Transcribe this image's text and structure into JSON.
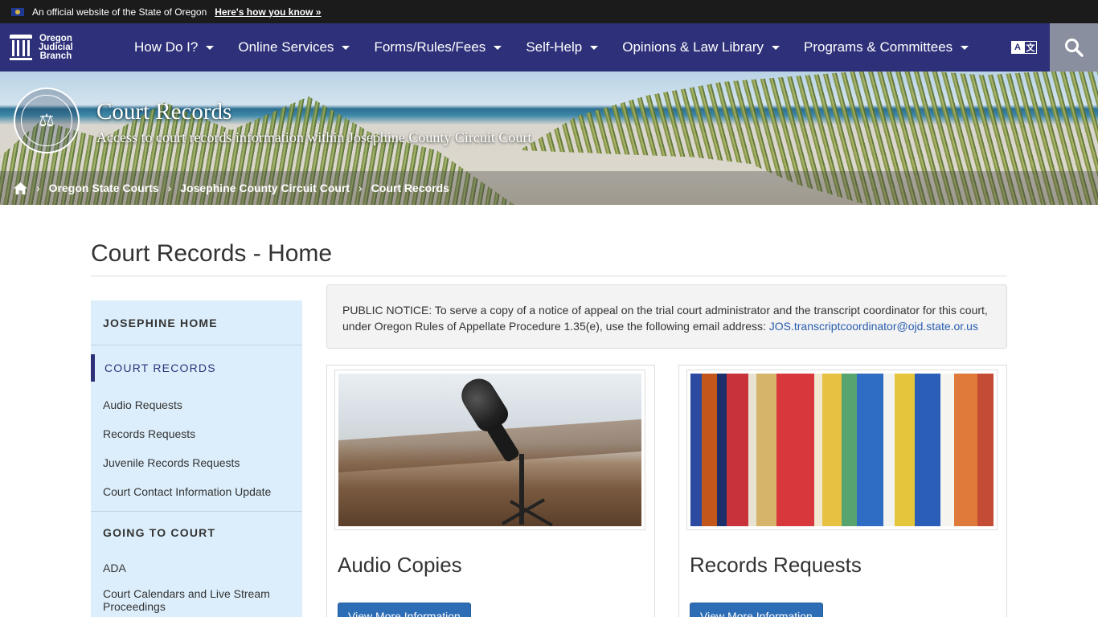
{
  "official_banner": {
    "text": "An official website of the State of Oregon",
    "link": "Here's how you know »"
  },
  "brand": {
    "line1": "Oregon",
    "line2": "Judicial",
    "line3": "Branch"
  },
  "nav": {
    "items": [
      {
        "label": "How Do I?"
      },
      {
        "label": "Online Services"
      },
      {
        "label": "Forms/Rules/Fees"
      },
      {
        "label": "Self-Help"
      },
      {
        "label": "Opinions & Law Library"
      },
      {
        "label": "Programs & Committees"
      }
    ],
    "translate_a": "A",
    "translate_b": "文"
  },
  "hero": {
    "title": "Court Records",
    "subtitle": "Access to court records information within Josephine County Circuit Court"
  },
  "breadcrumb": {
    "items": [
      {
        "label": "Oregon State Courts"
      },
      {
        "label": "Josephine County Circuit Court"
      },
      {
        "label": "Court Records"
      }
    ],
    "separator": "›"
  },
  "page": {
    "title": "Court Records - Home"
  },
  "sidebar": {
    "home": "JOSEPHINE HOME",
    "section1": {
      "heading": "COURT RECORDS",
      "items": [
        {
          "label": "Audio Requests"
        },
        {
          "label": "Records Requests"
        },
        {
          "label": "Juvenile Records Requests"
        },
        {
          "label": "Court Contact Information Update"
        }
      ]
    },
    "section2": {
      "heading": "GOING TO COURT",
      "items": [
        {
          "label": "ADA"
        },
        {
          "label": "Court Calendars and Live Stream Proceedings"
        }
      ]
    }
  },
  "notice": {
    "text": "PUBLIC NOTICE: To serve a copy of a notice of appeal on the trial court administrator and the transcript coordinator for this court, under Oregon Rules of Appellate Procedure 1.35(e), use the following email address:",
    "email": "JOS.transcriptcoordinator@ojd.state.or.us"
  },
  "cards": [
    {
      "title": "Audio Copies",
      "button": "View More Information"
    },
    {
      "title": "Records Requests",
      "button": "View More Information"
    }
  ],
  "colors": {
    "nav_bg": "#2e3179",
    "sidebar_bg": "#dceefb",
    "button_bg": "#2c6db5",
    "link": "#2a5db0"
  },
  "icons": [
    "oregon-flag-icon",
    "home-icon",
    "translate-icon",
    "search-icon",
    "chevron-down-icon",
    "seal-icon",
    "court-logo-icon"
  ]
}
